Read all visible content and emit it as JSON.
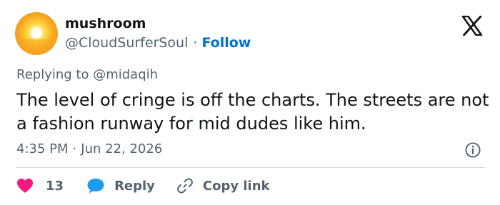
{
  "author": {
    "display_name": "mushroom",
    "handle": "@CloudSurferSoul",
    "separator": "·",
    "follow_label": "Follow",
    "avatar_icon": "sunset-avatar"
  },
  "platform_icon": "x-logo-icon",
  "reply_context": {
    "prefix": "Replying to",
    "handle": "@midaqih"
  },
  "tweet": {
    "text": "The level of cringe is off the charts. The streets are not a fashion runway for mid dudes like him.",
    "time": "4:35 PM",
    "separator": "·",
    "date": "Jun 22, 2026"
  },
  "actions": {
    "like_count": "13",
    "reply_label": "Reply",
    "copy_link_label": "Copy link"
  },
  "colors": {
    "follow": "#006fd6",
    "like": "#f91880",
    "reply": "#1d9bf0",
    "muted": "#536471",
    "text": "#0f1419"
  }
}
